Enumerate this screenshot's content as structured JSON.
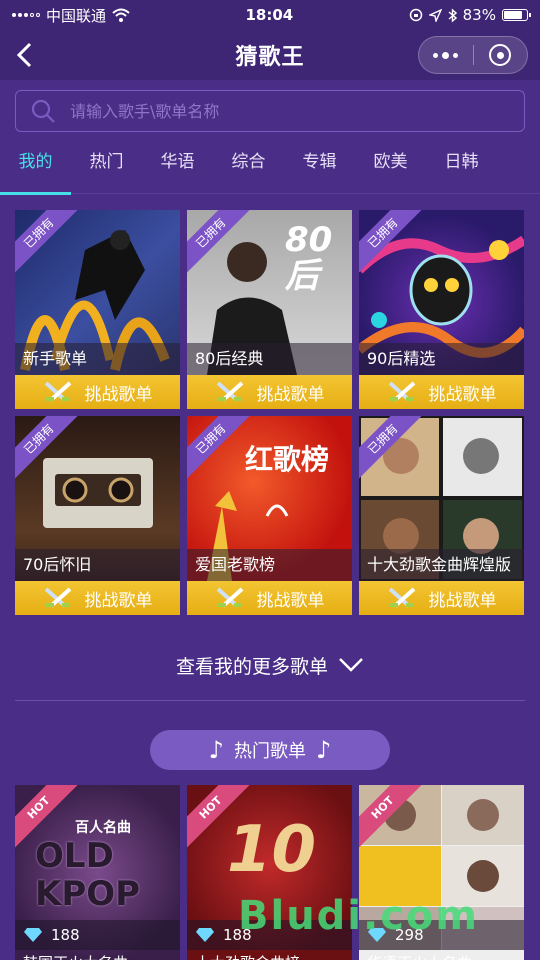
{
  "status_bar": {
    "carrier": "中国联通",
    "time": "18:04",
    "battery": "83%",
    "battery_level": 0.83
  },
  "nav": {
    "title": "猜歌王"
  },
  "search": {
    "placeholder": "请输入歌手\\歌单名称"
  },
  "tabs": [
    {
      "label": "我的",
      "active": true
    },
    {
      "label": "热门"
    },
    {
      "label": "华语"
    },
    {
      "label": "综合"
    },
    {
      "label": "专辑"
    },
    {
      "label": "欧美"
    },
    {
      "label": "日韩"
    }
  ],
  "my_playlists": [
    {
      "ribbon": "已拥有",
      "name": "新手歌单",
      "action": "挑战歌单"
    },
    {
      "ribbon": "已拥有",
      "name": "80后经典",
      "action": "挑战歌单",
      "art_text": "80后"
    },
    {
      "ribbon": "已拥有",
      "name": "90后精选",
      "action": "挑战歌单"
    },
    {
      "ribbon": "已拥有",
      "name": "70后怀旧",
      "action": "挑战歌单"
    },
    {
      "ribbon": "已拥有",
      "name": "爱国老歌榜",
      "action": "挑战歌单",
      "art_text": "红歌榜"
    },
    {
      "ribbon": "已拥有",
      "name": "十大劲歌金曲辉煌版",
      "action": "挑战歌单"
    }
  ],
  "more_link": "查看我的更多歌单",
  "hot_section": {
    "title": "热门歌单",
    "items": [
      {
        "ribbon": "HOT",
        "count": "188",
        "name": "韩国正火大名曲",
        "art_text": "OLD KPOP",
        "art_sub": "百人名曲"
      },
      {
        "ribbon": "HOT",
        "count": "188",
        "name": "十大劲歌金曲榜",
        "art_text": "10"
      },
      {
        "ribbon": "HOT",
        "count": "298",
        "name": "华语正火大名曲"
      }
    ]
  },
  "watermark": "Bludi.com",
  "colors": {
    "background": "#4a2d86",
    "accent_tab": "#48e0e8",
    "challenge_button": "#f3c532",
    "hot_ribbon": "#d94b7c"
  }
}
